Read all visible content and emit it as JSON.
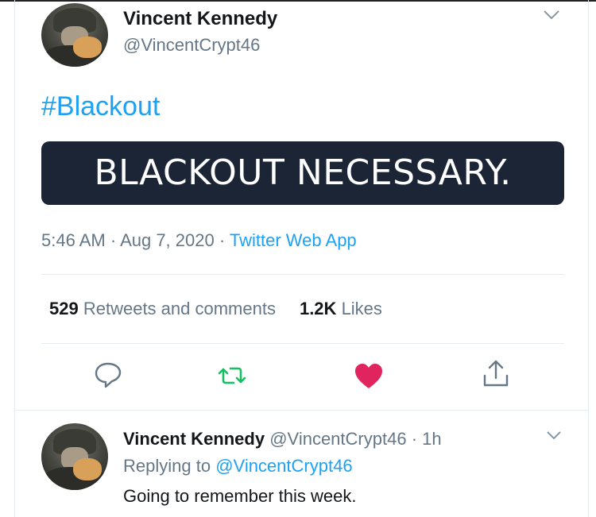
{
  "tweet": {
    "author_name": "Vincent Kennedy",
    "author_handle": "@VincentCrypt46",
    "hashtag": "#Blackout",
    "image_text": "BLACKOUT NECESSARY.",
    "time": "5:46 AM",
    "date": "Aug 7, 2020",
    "source": "Twitter Web App",
    "separator": " · ",
    "retweets_count": "529",
    "retweets_label": "Retweets and comments",
    "likes_count": "1.2K",
    "likes_label": "Likes",
    "liked": true
  },
  "reply": {
    "author_name": "Vincent Kennedy",
    "author_handle": "@VincentCrypt46",
    "age": "1h",
    "replying_prefix": "Replying to",
    "replying_to": "@VincentCrypt46",
    "text": "Going to remember this week."
  },
  "icons": [
    "chevron-down-icon",
    "reply-icon",
    "retweet-icon",
    "heart-icon",
    "share-icon"
  ],
  "colors": {
    "link": "#1da1f2",
    "secondary_text": "#657786",
    "retweet_green": "#17bf63",
    "like_red": "#e0245e",
    "banner_bg": "#1c2535"
  }
}
